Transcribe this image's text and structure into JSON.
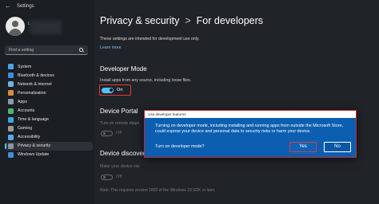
{
  "window": {
    "title": "Settings"
  },
  "profile": {
    "name": "L"
  },
  "search": {
    "placeholder": "Find a setting"
  },
  "sidebar": {
    "items": [
      {
        "label": "System",
        "icon": "system-icon",
        "color": "#4aa3e8"
      },
      {
        "label": "Bluetooth & devices",
        "icon": "bluetooth-icon",
        "color": "#3b8fe0"
      },
      {
        "label": "Network & internet",
        "icon": "network-icon",
        "color": "#6fb2ea"
      },
      {
        "label": "Personalization",
        "icon": "personalization-icon",
        "color": "#d98b3a"
      },
      {
        "label": "Apps",
        "icon": "apps-icon",
        "color": "#8a9bb0"
      },
      {
        "label": "Accounts",
        "icon": "accounts-icon",
        "color": "#47b86a"
      },
      {
        "label": "Time & language",
        "icon": "time-language-icon",
        "color": "#3fa6e0"
      },
      {
        "label": "Gaming",
        "icon": "gaming-icon",
        "color": "#9a9a9a"
      },
      {
        "label": "Accessibility",
        "icon": "accessibility-icon",
        "color": "#5aa9e6"
      },
      {
        "label": "Privacy & security",
        "icon": "shield-icon",
        "color": "#8a95a3",
        "active": true
      },
      {
        "label": "Windows Update",
        "icon": "windows-update-icon",
        "color": "#3f8fe0"
      }
    ]
  },
  "main": {
    "breadcrumb": {
      "parent": "Privacy & security",
      "separator": ">",
      "current": "For developers"
    },
    "intro": "These settings are intended for development use only.",
    "learn_more": "Learn more",
    "developer_mode": {
      "title": "Developer Mode",
      "description": "Install apps from any source, including loose files.",
      "state_label": "On",
      "on": true
    },
    "device_portal": {
      "title": "Device Portal",
      "description": "Turn on remote diagn",
      "state_label": "Off"
    },
    "device_discovery": {
      "title": "Device discover",
      "description": "Make your device visi",
      "state_label": "Off"
    },
    "footnote": "Note: This requires version 1803 of the Windows 10 SDK or later."
  },
  "dialog": {
    "title": "Use developer features",
    "body": "Turning on developer mode, including installing and running apps from outside the Microsoft Store, could expose your device and personal data to security risks or harm your device.",
    "question": "Turn on developer mode?",
    "yes_label": "Yes",
    "no_label": "No"
  },
  "colors": {
    "accent": "#4cc2ff",
    "dialog_bg": "#0c5fb0",
    "highlight": "#e43a3a"
  }
}
